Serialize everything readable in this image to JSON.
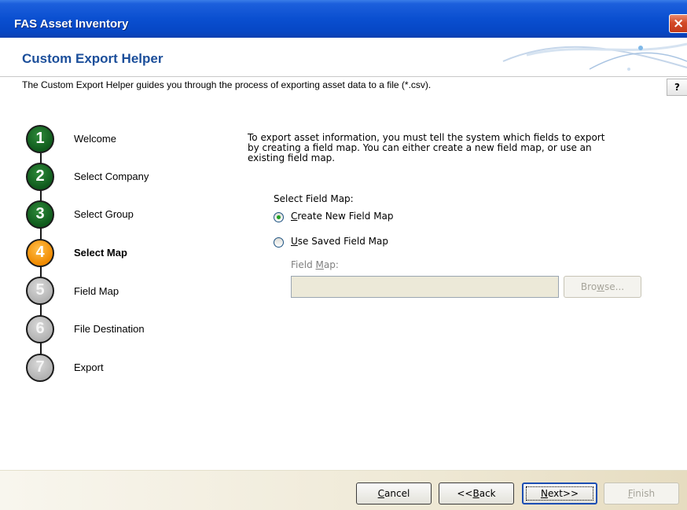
{
  "window": {
    "title": "FAS Asset Inventory",
    "close_label": "×"
  },
  "header": {
    "title": "Custom Export Helper"
  },
  "description": "The Custom Export Helper guides you through the process of exporting asset data to a file (*.csv).",
  "help_label": "?",
  "steps": [
    {
      "number": "1",
      "label": "Welcome",
      "state": "done"
    },
    {
      "number": "2",
      "label": "Select Company",
      "state": "done"
    },
    {
      "number": "3",
      "label": "Select Group",
      "state": "done"
    },
    {
      "number": "4",
      "label": "Select Map",
      "state": "current"
    },
    {
      "number": "5",
      "label": "Field Map",
      "state": "todo"
    },
    {
      "number": "6",
      "label": "File Destination",
      "state": "todo"
    },
    {
      "number": "7",
      "label": "Export",
      "state": "todo"
    }
  ],
  "main": {
    "intro_line1": "To export asset information, you must tell the system which fields to export",
    "intro_line2": "by creating a field map. You can either create a new field map, or use an",
    "intro_line3": "existing field map.",
    "select_label": "Select Field Map:",
    "option_create": {
      "accel": "C",
      "rest": "reate New Field Map",
      "selected": true
    },
    "option_saved": {
      "accel": "U",
      "rest": "se Saved Field Map",
      "selected": false
    },
    "field_map_label_pre": "Field ",
    "field_map_label_accel": "M",
    "field_map_label_post": "ap:",
    "field_map_value": "",
    "browse_pre": "Bro",
    "browse_accel": "w",
    "browse_post": "se..."
  },
  "footer": {
    "cancel_accel": "C",
    "cancel_rest": "ancel",
    "back_pre": "<<",
    "back_accel": "B",
    "back_post": "ack",
    "next_accel": "N",
    "next_rest": "ext>>",
    "finish_accel": "F",
    "finish_rest": "inish"
  },
  "colors": {
    "titlebar": "#0a4fd0",
    "header_title": "#1b4e9a",
    "step_done": "#0f5a1c",
    "step_current": "#f08a00",
    "step_todo": "#b2b2b2",
    "radio_dot": "#21a121"
  }
}
